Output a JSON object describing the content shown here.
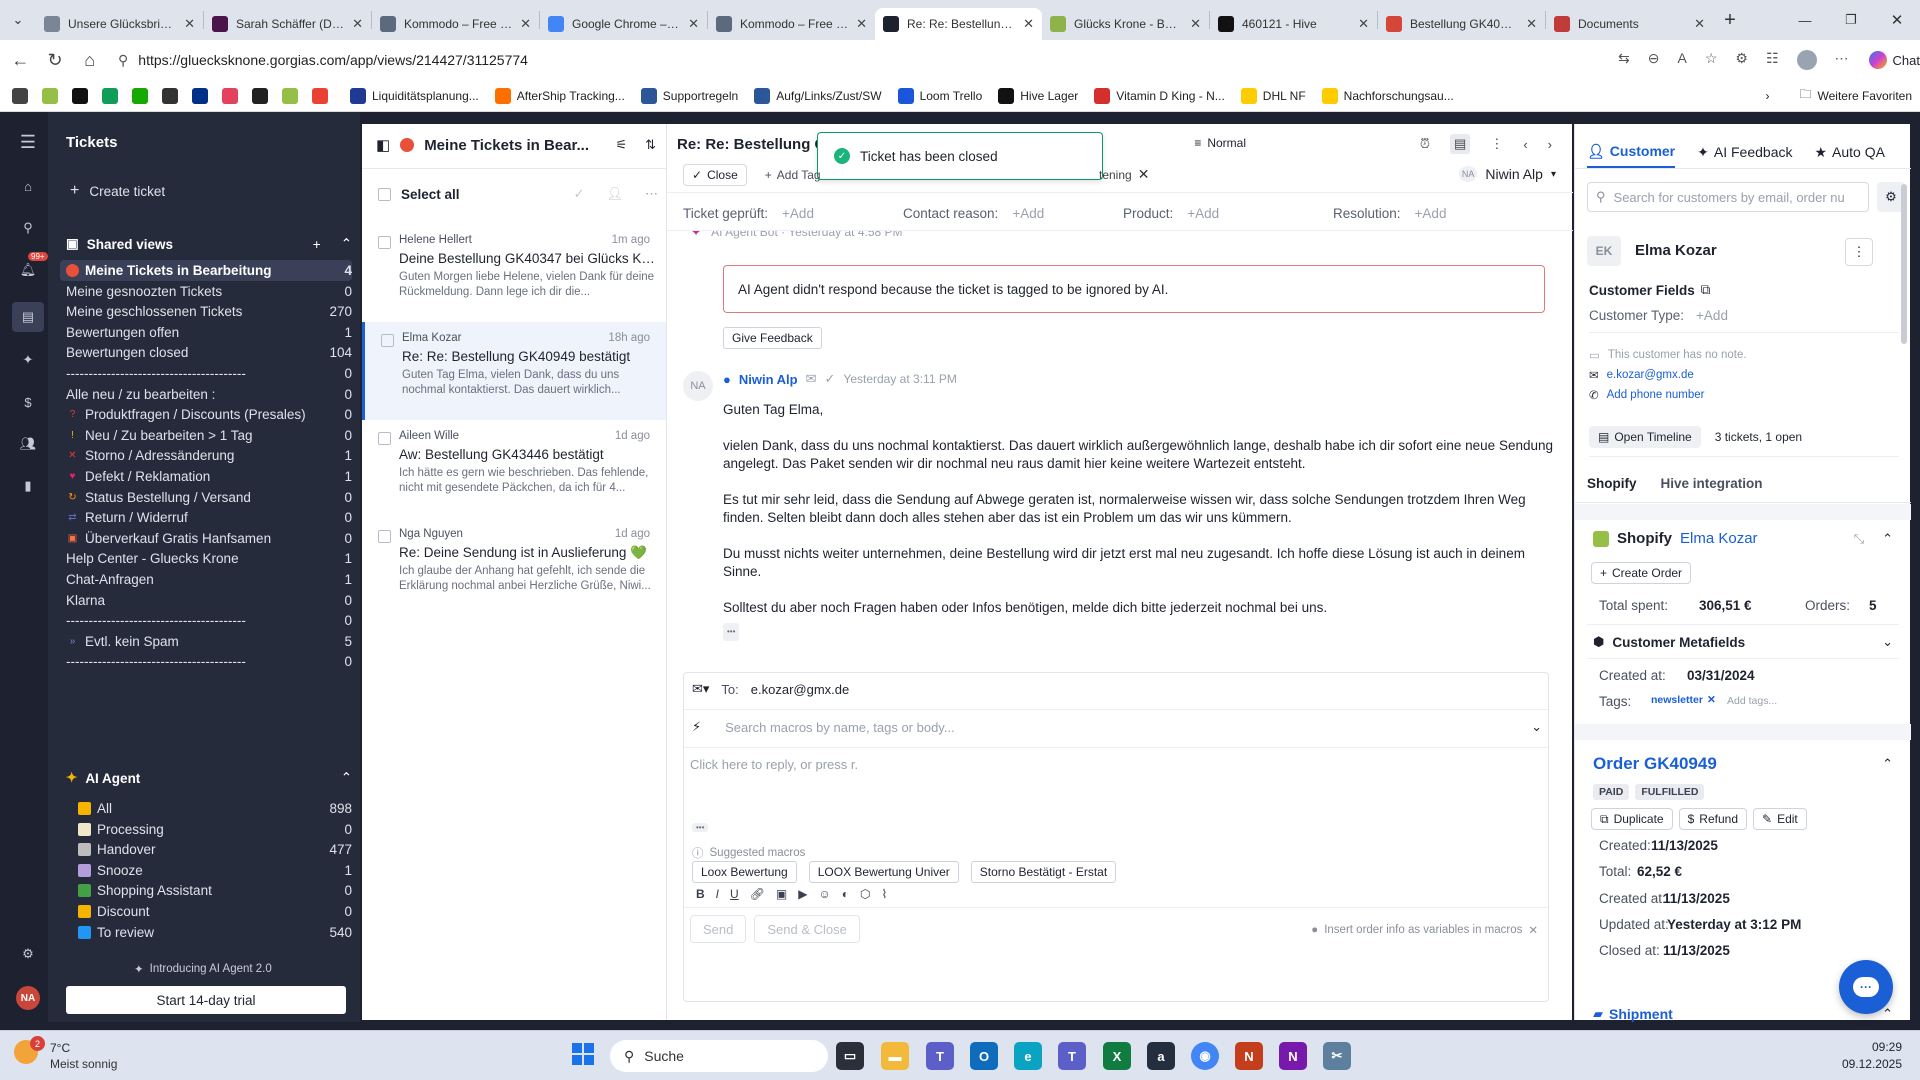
{
  "browser": {
    "tabs": [
      {
        "title": "Unsere Glücksbringer",
        "color": "#7a8596"
      },
      {
        "title": "Sarah Schäffer (DM)",
        "color": "#4a154b"
      },
      {
        "title": "Kommodo – Free Sc",
        "color": "#5b6b7d"
      },
      {
        "title": "Google Chrome – de",
        "color": "#4285f4"
      },
      {
        "title": "Kommodo – Free Sc",
        "color": "#5b6b7d"
      },
      {
        "title": "Re: Re: Bestellung G",
        "color": "#1d2130",
        "active": true
      },
      {
        "title": "Glücks Krone - Beste",
        "color": "#8fb24b"
      },
      {
        "title": "460121 - Hive",
        "color": "#111111"
      },
      {
        "title": "Bestellung GK40949",
        "color": "#d44638"
      },
      {
        "title": "Documents",
        "color": "#c13b3b"
      }
    ],
    "url": "https://gluecksknone.gorgias.com/app/views/214427/31125774",
    "chat_label": "Chat",
    "bookmarks": [
      {
        "label": "Liquiditätsplanung...",
        "color": "#1f3a93"
      },
      {
        "label": "AfterShip Tracking...",
        "color": "#ff6f00"
      },
      {
        "label": "Supportregeln",
        "color": "#2b579a"
      },
      {
        "label": "Aufg/Links/Zust/SW",
        "color": "#2b579a"
      },
      {
        "label": "Loom Trello",
        "color": "#1a56db"
      },
      {
        "label": "Hive Lager",
        "color": "#111111"
      },
      {
        "label": "Vitamin D King - N...",
        "color": "#d32f2f"
      },
      {
        "label": "DHL NF",
        "color": "#ffcc00"
      },
      {
        "label": "Nachforschungsau...",
        "color": "#ffcc00"
      }
    ],
    "more_bookmarks": "Weitere Favoriten"
  },
  "nav": {
    "title": "Tickets",
    "create": "Create ticket",
    "shared_views": "Shared views",
    "items": [
      {
        "label": "Meine Tickets in Bearbeitung",
        "count": "4",
        "icon": "#e8503a",
        "selected": true
      },
      {
        "label": "Meine gesnoozten Tickets",
        "count": "0"
      },
      {
        "label": "Meine geschlossenen Tickets",
        "count": "270"
      },
      {
        "label": "Bewertungen offen",
        "count": "1"
      },
      {
        "label": "Bewertungen closed",
        "count": "104"
      },
      {
        "label": "----------------------------------------",
        "count": "0"
      },
      {
        "label": "Alle neu / zu bearbeiten :",
        "count": "0"
      },
      {
        "label": "Produktfragen / Discounts (Presales)",
        "count": "0",
        "icon": "#e53935",
        "glyph": "?"
      },
      {
        "label": "Neu / Zu bearbeiten > 1 Tag",
        "count": "0",
        "icon": "#f5b400",
        "glyph": "!"
      },
      {
        "label": "Storno / Adressänderung",
        "count": "1",
        "icon": "#e53935",
        "glyph": "✕"
      },
      {
        "label": "Defekt / Reklamation",
        "count": "1",
        "icon": "#e91e63",
        "glyph": "♥"
      },
      {
        "label": "Status Bestellung / Versand",
        "count": "0",
        "icon": "#ff9800",
        "glyph": "↻"
      },
      {
        "label": "Return / Widerruf",
        "count": "0",
        "icon": "#5c6bc0",
        "glyph": "⇄"
      },
      {
        "label": "Überverkauf Gratis Hanfsamen",
        "count": "0",
        "icon": "#ff7043",
        "glyph": "▣"
      },
      {
        "label": "Help Center - Gluecks Krone",
        "count": "1"
      },
      {
        "label": "Chat-Anfragen",
        "count": "1"
      },
      {
        "label": "Klarna",
        "count": "0"
      },
      {
        "label": "----------------------------------------",
        "count": "0"
      },
      {
        "label": "Evtl. kein Spam",
        "count": "5",
        "icon": "#7986cb",
        "glyph": "»"
      },
      {
        "label": "----------------------------------------",
        "count": "0"
      }
    ],
    "ai_agent": "AI Agent",
    "ai_items": [
      {
        "label": "All",
        "count": "898",
        "icon": "#f5b400"
      },
      {
        "label": "Processing",
        "count": "0",
        "icon": "#f0e6c8"
      },
      {
        "label": "Handover",
        "count": "477",
        "icon": "#bdbdbd"
      },
      {
        "label": "Snooze",
        "count": "1",
        "icon": "#b39ddb"
      },
      {
        "label": "Shopping Assistant",
        "count": "0",
        "icon": "#43a047"
      },
      {
        "label": "Discount",
        "count": "0",
        "icon": "#f5b400"
      },
      {
        "label": "To review",
        "count": "540",
        "icon": "#2196f3"
      }
    ],
    "intro": "Introducing AI Agent 2.0",
    "trial": "Start 14-day trial"
  },
  "list": {
    "title": "Meine Tickets in Bear...",
    "select_all": "Select all",
    "tickets": [
      {
        "name": "Helene Hellert",
        "time": "1m ago",
        "subject": "Deine Bestellung GK40347 bei Glücks Kr...",
        "preview": "Guten Morgen liebe Helene, vielen Dank für deine Rückmeldung. Dann lege ich dir die..."
      },
      {
        "name": "Elma Kozar",
        "time": "18h ago",
        "subject": "Re: Re: Bestellung GK40949 bestätigt",
        "preview": "Guten Tag Elma, vielen Dank, dass du uns nochmal kontaktierst. Das dauert wirklich...",
        "selected": true
      },
      {
        "name": "Aileen Wille",
        "time": "1d ago",
        "subject": "Aw: Bestellung GK43446 bestätigt",
        "preview": "Ich hätte es gern wie beschrieben. Das fehlende, nicht mit gesendete Päckchen, da ich für 4..."
      },
      {
        "name": "Nga Nguyen",
        "time": "1d ago",
        "subject": "Re: Deine Sendung ist in Auslieferung 💚",
        "preview": "Ich glaube der Anhang hat gefehlt, ich sende die Erklärung nochmal anbei Herzliche Grüße, Niwi..."
      }
    ]
  },
  "ticket": {
    "subject": "Re: Re: Bestellung G",
    "toast": "Ticket has been closed",
    "priority": "Normal",
    "close_btn": "Close",
    "add_tags": "Add Tag",
    "tag_tail": "tening",
    "assignee_initials": "NA",
    "assignee": "Niwin Alp",
    "fields": [
      {
        "label": "Ticket geprüft:",
        "value": "+Add"
      },
      {
        "label": "Contact reason:",
        "value": "+Add"
      },
      {
        "label": "Product:",
        "value": "+Add"
      },
      {
        "label": "Resolution:",
        "value": "+Add"
      }
    ],
    "bot_header": "AI Agent Bot · Yesterday at 4:58 PM",
    "ai_notice": "AI Agent didn't respond because the ticket is tagged to be ignored by AI.",
    "feedback": "Give Feedback",
    "msg_initials": "NA",
    "msg_author": "Niwin Alp",
    "msg_time": "Yesterday at 3:11 PM",
    "msg_greeting": "Guten Tag Elma,",
    "msg_p1": "vielen Dank, dass du uns nochmal kontaktierst. Das dauert wirklich außergewöhnlich lange, deshalb habe ich dir sofort eine neue Sendung angelegt. Das Paket senden wir dir nochmal neu raus damit hier keine weitere Wartezeit entsteht.",
    "msg_p2": "Es tut mir sehr leid, dass die Sendung auf Abwege geraten ist, normalerweise wissen wir, dass solche Sendungen trotzdem Ihren Weg finden. Selten bleibt dann doch alles stehen aber das ist ein Problem um das wir uns kümmern.",
    "msg_p3": "Du musst nichts weiter unternehmen, deine Bestellung wird dir jetzt erst mal neu zugesandt. Ich hoffe diese Lösung ist auch in deinem Sinne.",
    "msg_p4": "Solltest du aber noch Fragen haben oder Infos benötigen, melde dich bitte jederzeit nochmal bei uns.",
    "ellipsis": "•••",
    "to_label": "To:",
    "to_value": "e.kozar@gmx.de",
    "macro_placeholder": "Search macros by name, tags or body...",
    "reply_placeholder": "Click here to reply, or press r.",
    "suggested": "Suggested macros",
    "macros": [
      "Loox Bewertung",
      "LOOX Bewertung Univer",
      "Storno Bestätigt - Erstat"
    ],
    "send": "Send",
    "send_close": "Send & Close",
    "insert_hint": "Insert order info as variables in macros"
  },
  "customer": {
    "tabs": [
      "Customer",
      "AI Feedback",
      "Auto QA"
    ],
    "search_placeholder": "Search for customers by email, order nu",
    "initials": "EK",
    "name": "Elma Kozar",
    "fields_title": "Customer Fields",
    "type_label": "Customer Type:",
    "type_value": "+Add",
    "note": "This customer has no note.",
    "email": "e.kozar@gmx.de",
    "phone": "Add phone number",
    "timeline": "Open Timeline",
    "tickets_summary": "3 tickets, 1 open",
    "integration_tabs": [
      "Shopify",
      "Hive integration"
    ],
    "shopify_title": "Shopify",
    "shopify_name": "Elma Kozar",
    "create_order": "Create Order",
    "total_spent_label": "Total spent:",
    "total_spent": "306,51 €",
    "orders_label": "Orders:",
    "orders": "5",
    "metafields": "Customer Metafields",
    "created_label": "Created at:",
    "created": "03/31/2024",
    "tags_label": "Tags:",
    "tag": "newsletter",
    "add_tags": "Add tags...",
    "order_title": "Order GK40949",
    "order_badges": [
      "PAID",
      "FULFILLED"
    ],
    "order_actions": [
      "Duplicate",
      "Refund",
      "Edit"
    ],
    "order_fields": [
      {
        "label": "Created:",
        "value": "11/13/2025"
      },
      {
        "label": "Total:",
        "value": "62,52 €"
      },
      {
        "label": "Created at:",
        "value": "11/13/2025"
      },
      {
        "label": "Updated at:",
        "value": "Yesterday at 3:12 PM"
      },
      {
        "label": "Closed at:",
        "value": "11/13/2025"
      }
    ],
    "shipment": "Shipment"
  },
  "taskbar": {
    "temp": "7°C",
    "weather": "Meist sonnig",
    "weather_badge": "2",
    "search": "Suche",
    "time": "09:29",
    "date": "09.12.2025"
  }
}
